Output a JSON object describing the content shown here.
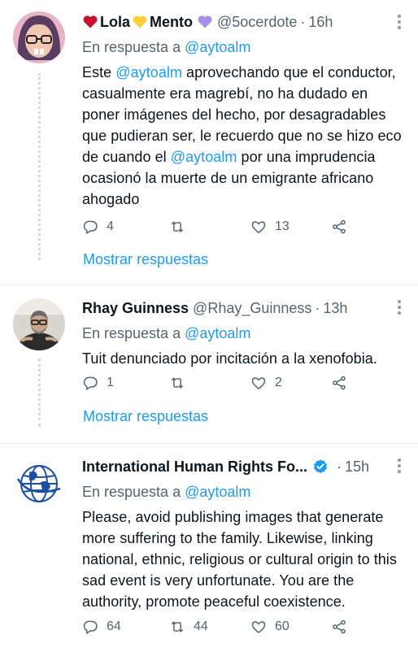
{
  "tweets": [
    {
      "name_part1": "Lola",
      "name_part2": "Mento",
      "handle": "@5ocerdote",
      "dot": "·",
      "time": "16h",
      "reply_prefix": "En respuesta a",
      "reply_to": "@aytoalm",
      "body": {
        "seg1": "Este ",
        "mention1": "@aytoalm",
        "seg2": " aprovechando que el conductor, casualmente era magrebí, no ha dudado en poner imágenes del hecho, por desagradables que pudieran ser, le recuerdo que no se hizo eco de cuando el ",
        "mention2": "@aytoalm",
        "seg3": " por una imprudencia ocasionó la muerte de un emigrante africano ahogado"
      },
      "replies": "4",
      "retweets": "",
      "likes": "13",
      "show_replies": "Mostrar respuestas"
    },
    {
      "name": "Rhay Guinness",
      "handle": "@Rhay_Guinness",
      "dot": "·",
      "time": "13h",
      "reply_prefix": "En respuesta a",
      "reply_to": "@aytoalm",
      "body": "Tuit denunciado por incitación a la xenofobia.",
      "replies": "1",
      "retweets": "",
      "likes": "2",
      "show_replies": "Mostrar respuestas"
    },
    {
      "name": "International Human Rights Fo...",
      "handle": "",
      "dot": "·",
      "time": "15h",
      "reply_prefix": "En respuesta a",
      "reply_to": "@aytoalm",
      "body": "Please, avoid publishing images that generate more suffering to the family. Likewise, linking national, ethnic, religious or cultural origin to this sad event is very unfortunate. You are the authority, promote peaceful coexistence.",
      "replies": "64",
      "retweets": "44",
      "likes": "60"
    }
  ],
  "colors": {
    "accent": "#1d9bf0",
    "secondary": "#536471",
    "heart": "#c8102e",
    "yellow_heart": "#ffcf40",
    "purple_heart": "#a98ee6"
  },
  "icons": [
    "red-heart-emoji",
    "yellow-heart-emoji",
    "purple-heart-emoji",
    "verified-badge-icon",
    "reply-icon",
    "retweet-icon",
    "like-icon",
    "share-icon",
    "more-options-icon"
  ]
}
